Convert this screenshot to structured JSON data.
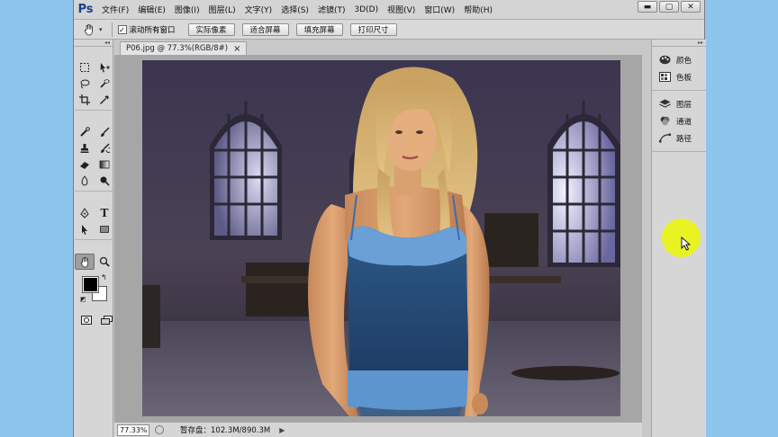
{
  "app": {
    "logo": "Ps"
  },
  "menu": [
    "文件(F)",
    "编辑(E)",
    "图像(I)",
    "图层(L)",
    "文字(Y)",
    "选择(S)",
    "滤镜(T)",
    "3D(D)",
    "视图(V)",
    "窗口(W)",
    "帮助(H)"
  ],
  "window_controls": {
    "minimize": "▬",
    "maximize": "▢",
    "close": "✕"
  },
  "options": {
    "scroll_all_label": "滚动所有窗口",
    "scroll_all_checked": true,
    "actual_pixels": "实际像素",
    "fit_screen": "适合屏幕",
    "fill_screen": "填充屏幕",
    "print_size": "打印尺寸"
  },
  "document": {
    "tab_title": "P06.jpg @ 77.3%(RGB/8#)",
    "close_glyph": "×"
  },
  "status": {
    "zoom": "77.33%",
    "info": "暂存盘：102.3M/890.3M",
    "arrow": "▶"
  },
  "panels": [
    {
      "id": "color",
      "label": "颜色",
      "icon": "palette-icon"
    },
    {
      "id": "swatches",
      "label": "色板",
      "icon": "swatches-icon"
    },
    {
      "id": "layers",
      "label": "图层",
      "icon": "layers-icon"
    },
    {
      "id": "channels",
      "label": "通道",
      "icon": "channels-icon"
    },
    {
      "id": "paths",
      "label": "路径",
      "icon": "paths-icon"
    }
  ],
  "colors": {
    "foreground": "#000000",
    "background": "#ffffff",
    "cursor_highlight": "#eaf41a",
    "desktop": "#8ec5ee"
  }
}
